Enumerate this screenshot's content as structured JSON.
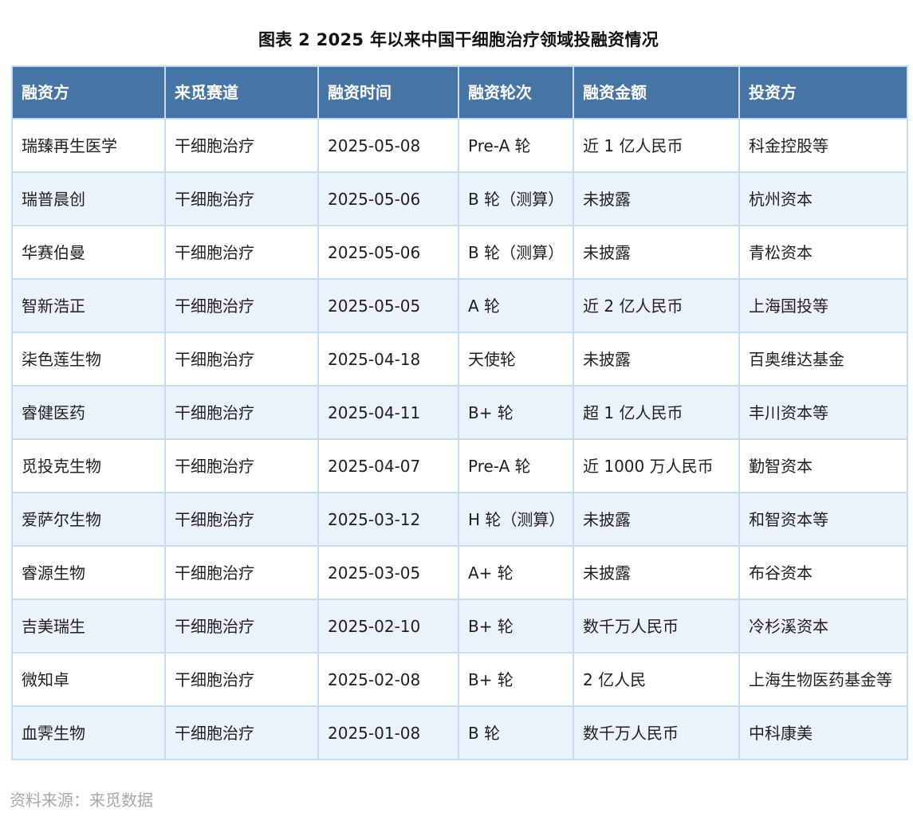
{
  "title": "图表 2 2025 年以来中国干细胞治疗领域投融资情况",
  "table": {
    "headers": [
      "融资方",
      "来觅赛道",
      "融资时间",
      "融资轮次",
      "融资金额",
      "投资方"
    ],
    "rows": [
      [
        "瑞臻再生医学",
        "干细胞治疗",
        "2025-05-08",
        "Pre-A 轮",
        "近 1 亿人民币",
        "科金控股等"
      ],
      [
        "瑞普晨创",
        "干细胞治疗",
        "2025-05-06",
        "B 轮（测算）",
        "未披露",
        "杭州资本"
      ],
      [
        "华赛伯曼",
        "干细胞治疗",
        "2025-05-06",
        "B 轮（测算）",
        "未披露",
        "青松资本"
      ],
      [
        "智新浩正",
        "干细胞治疗",
        "2025-05-05",
        "A 轮",
        "近 2 亿人民币",
        "上海国投等"
      ],
      [
        "柒色莲生物",
        "干细胞治疗",
        "2025-04-18",
        "天使轮",
        "未披露",
        "百奥维达基金"
      ],
      [
        "睿健医药",
        "干细胞治疗",
        "2025-04-11",
        "B+ 轮",
        "超 1 亿人民币",
        "丰川资本等"
      ],
      [
        "觅投克生物",
        "干细胞治疗",
        "2025-04-07",
        "Pre-A 轮",
        "近 1000 万人民币",
        "勤智资本"
      ],
      [
        "爱萨尔生物",
        "干细胞治疗",
        "2025-03-12",
        "H 轮（测算）",
        "未披露",
        "和智资本等"
      ],
      [
        "睿源生物",
        "干细胞治疗",
        "2025-03-05",
        "A+ 轮",
        "未披露",
        "布谷资本"
      ],
      [
        "吉美瑞生",
        "干细胞治疗",
        "2025-02-10",
        "B+ 轮",
        "数千万人民币",
        "冷杉溪资本"
      ],
      [
        "微知卓",
        "干细胞治疗",
        "2025-02-08",
        "B+ 轮",
        "2 亿人民",
        "上海生物医药基金等"
      ],
      [
        "血霁生物",
        "干细胞治疗",
        "2025-01-08",
        "B 轮",
        "数千万人民币",
        "中科康美"
      ]
    ]
  },
  "source": "资料来源：来觅数据",
  "colors": {
    "header_bg": "#4674a4",
    "header_text": "#ffffff",
    "row_alt_bg": "#eaf2fc",
    "border": "#c7dcf2",
    "source_text": "#a8a8a8"
  }
}
